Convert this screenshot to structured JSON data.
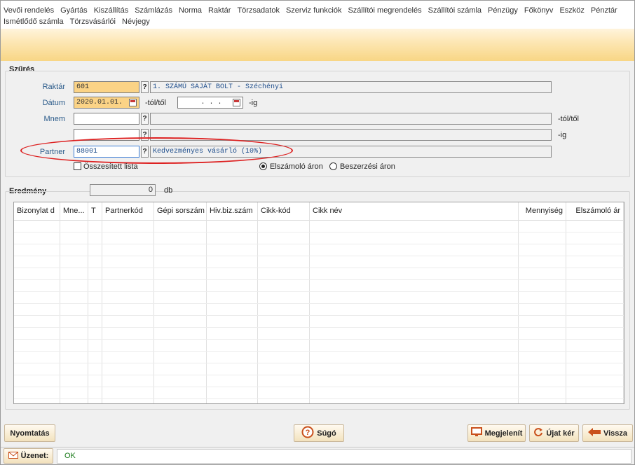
{
  "menu": {
    "row1": [
      "Vevői rendelés",
      "Gyártás",
      "Kiszállítás",
      "Számlázás",
      "Norma",
      "Raktár",
      "Törzsadatok",
      "Szerviz funkciók",
      "Szállítói megrendelés",
      "Szállítói számla",
      "Pénzügy",
      "Főkönyv",
      "Eszköz",
      "Pénztár"
    ],
    "row2": [
      "Ismétlődő számla",
      "Törzsvásárlói",
      "Névjegy"
    ]
  },
  "filter": {
    "title": "Szűrés",
    "raktar_label": "Raktár",
    "raktar_value": "601",
    "raktar_desc": "1. SZÁMÚ SAJÁT BOLT - Széchényi",
    "datum_label": "Dátum",
    "datum_from": "2020.01.01.",
    "datum_from_suffix": "-tól/től",
    "datum_to": ".   .   .",
    "datum_to_suffix": "-ig",
    "mnem_label": "Mnem",
    "mnem_from_suffix": "-tól/től",
    "mnem_to_suffix": "-ig",
    "partner_label": "Partner",
    "partner_value": "88001",
    "partner_desc": "Kedvezményes vásárló (10%)",
    "osszesitett_label": "Összesített lista",
    "radio_elszamolo": "Elszámoló áron",
    "radio_beszerzesi": "Beszerzési áron",
    "selected_price": "Elszámoló áron",
    "qmark": "?"
  },
  "result": {
    "title": "Eredmény",
    "count": "0",
    "count_unit": "db",
    "columns": [
      "Bizonylat d",
      "Mne...",
      "T",
      "Partnerkód",
      "Gépi sorszám",
      "Hiv.biz.szám",
      "Cikk-kód",
      "Cikk név",
      "Mennyiség",
      "Elszámoló ár"
    ]
  },
  "buttons": {
    "print": "Nyomtatás",
    "help": "Súgó",
    "show": "Megjelenít",
    "new": "Újat kér",
    "back": "Vissza"
  },
  "status": {
    "label": "Üzenet:",
    "message": "OK"
  },
  "colors": {
    "accent_yellow": "#fbd386",
    "highlight_red": "#dd2222",
    "status_ok": "#1a7a1a"
  }
}
